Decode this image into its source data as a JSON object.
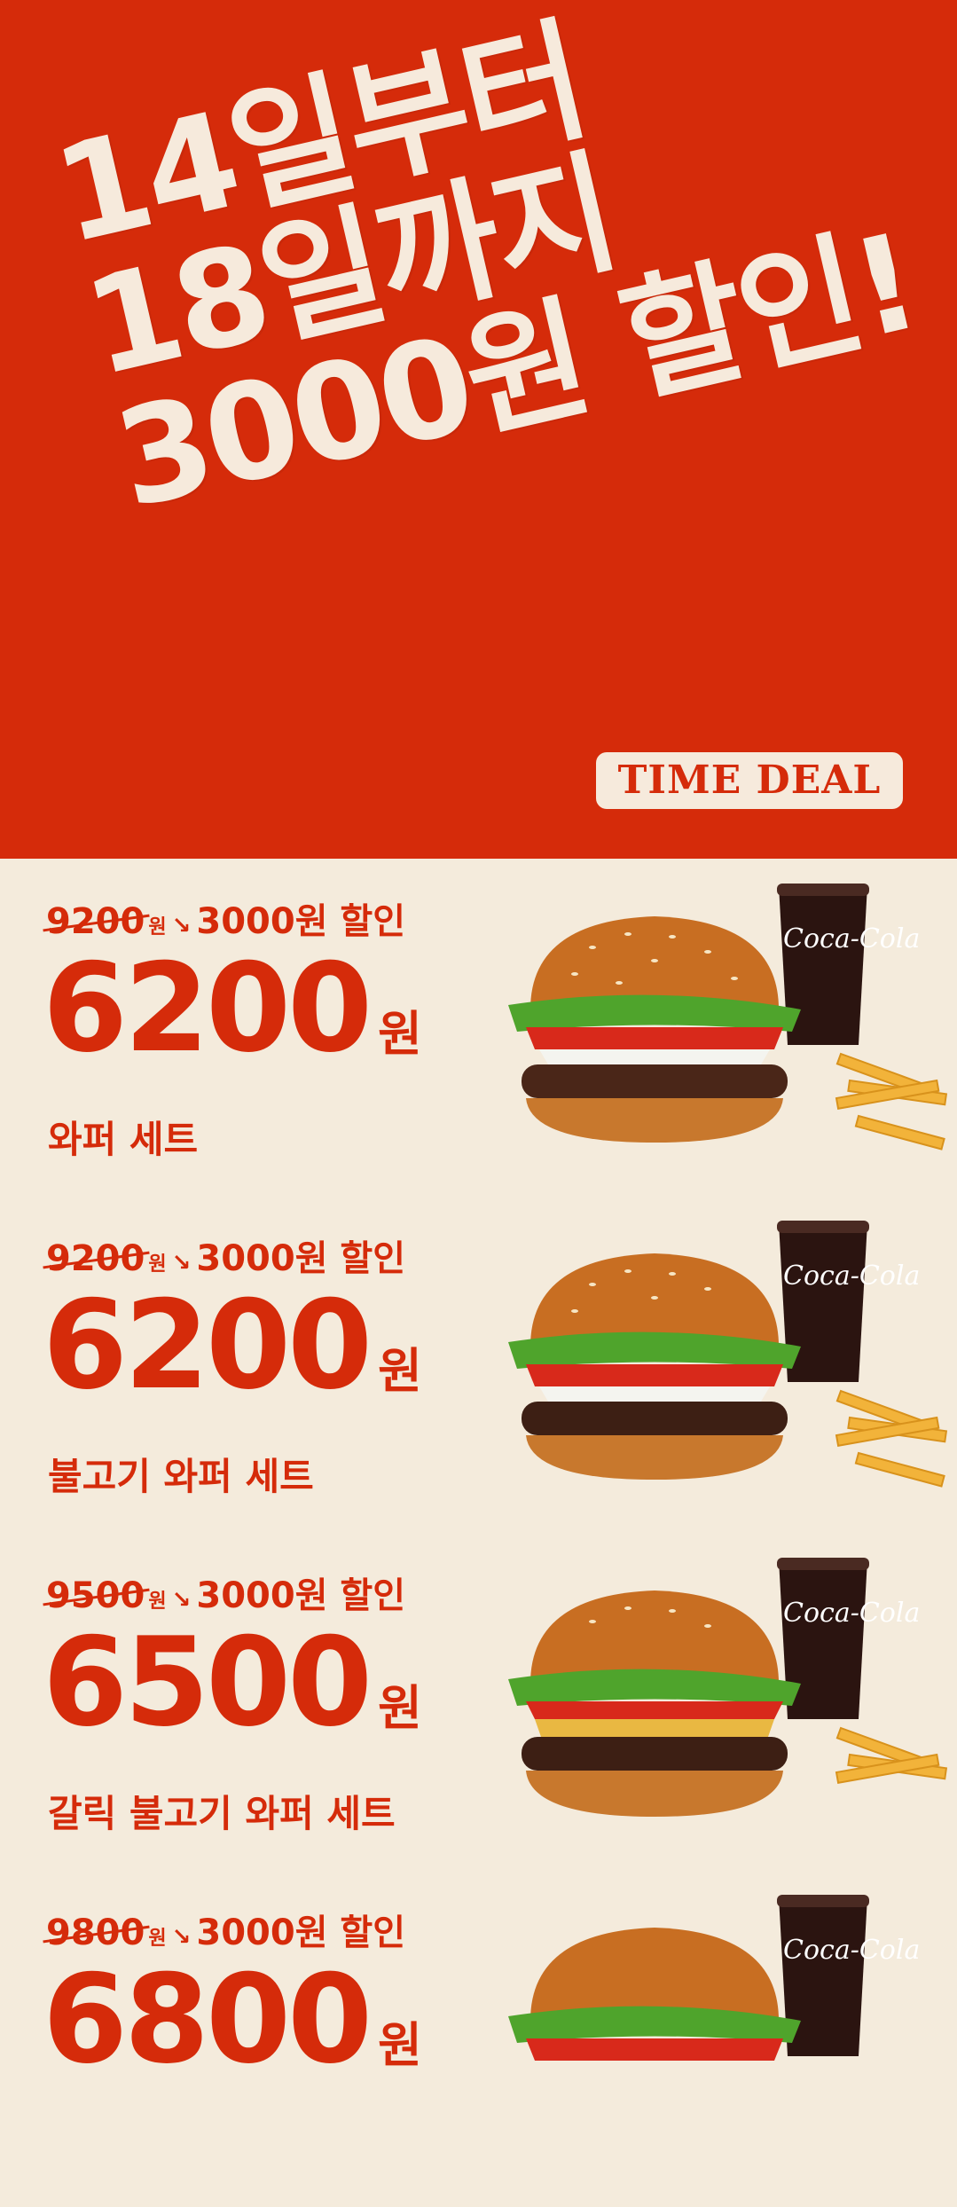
{
  "hero": {
    "headline": [
      "14일부터",
      "18일까지",
      "3000원 할인!"
    ],
    "badge": "TIME DEAL",
    "colors": {
      "background": "#d52b0a",
      "text": "#f6eadc"
    }
  },
  "deals": [
    {
      "original_price": "9200",
      "won_small": "원",
      "discount": "3000원 할인",
      "price": "6200",
      "won": "원",
      "name": "와퍼 세트"
    },
    {
      "original_price": "9200",
      "won_small": "원",
      "discount": "3000원 할인",
      "price": "6200",
      "won": "원",
      "name": "불고기 와퍼 세트"
    },
    {
      "original_price": "9500",
      "won_small": "원",
      "discount": "3000원 할인",
      "price": "6500",
      "won": "원",
      "name": "갈릭 불고기 와퍼 세트"
    },
    {
      "original_price": "9800",
      "won_small": "원",
      "discount": "3000원 할인",
      "price": "6800",
      "won": "원",
      "name": ""
    }
  ],
  "colors": {
    "accent": "#d52b0a",
    "cream": "#f4ebdc"
  },
  "icons": {
    "arrow": "arrow-down-right-icon",
    "image": "burger-set-image"
  }
}
